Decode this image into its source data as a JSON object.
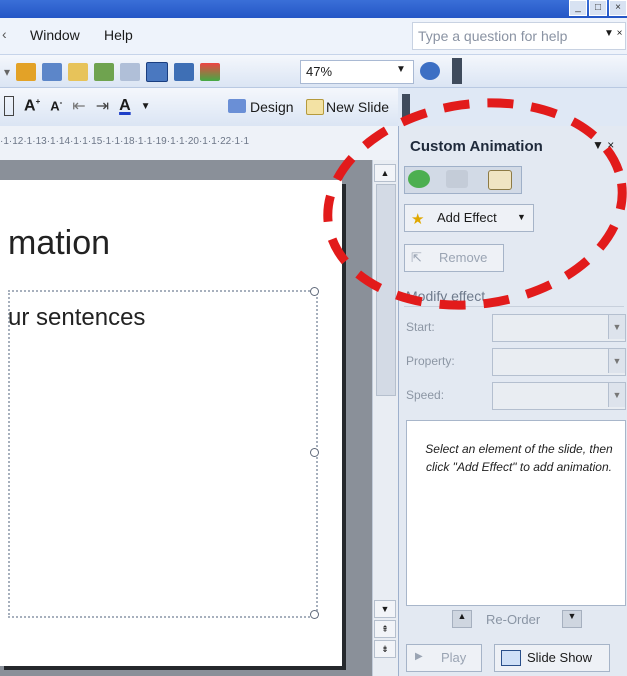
{
  "menubar": {
    "items": [
      "Window",
      "Help"
    ],
    "help_placeholder": "Type a question for help"
  },
  "toolbar": {
    "zoom": "47%",
    "design_label": "Design",
    "new_slide_label": "New Slide"
  },
  "ruler": {
    "ticks": "·1·12·1·13·1·14·1·1·15·1·1·18·1·1·19·1·1·20·1·1·22·1·1"
  },
  "slide": {
    "title_fragment": "mation",
    "body_fragment": "ur sentences"
  },
  "taskpane": {
    "title": "Custom Animation",
    "add_effect": "Add Effect",
    "remove": "Remove",
    "modify_label": "Modify effect",
    "start_label": "Start:",
    "property_label": "Property:",
    "speed_label": "Speed:",
    "hint": "Select an element of the slide, then click \"Add Effect\" to add animation.",
    "reorder": "Re-Order",
    "play": "Play",
    "slide_show": "Slide Show"
  },
  "colors": {
    "annotation": "#e21b1b",
    "titlebar": "#2f63cf"
  }
}
